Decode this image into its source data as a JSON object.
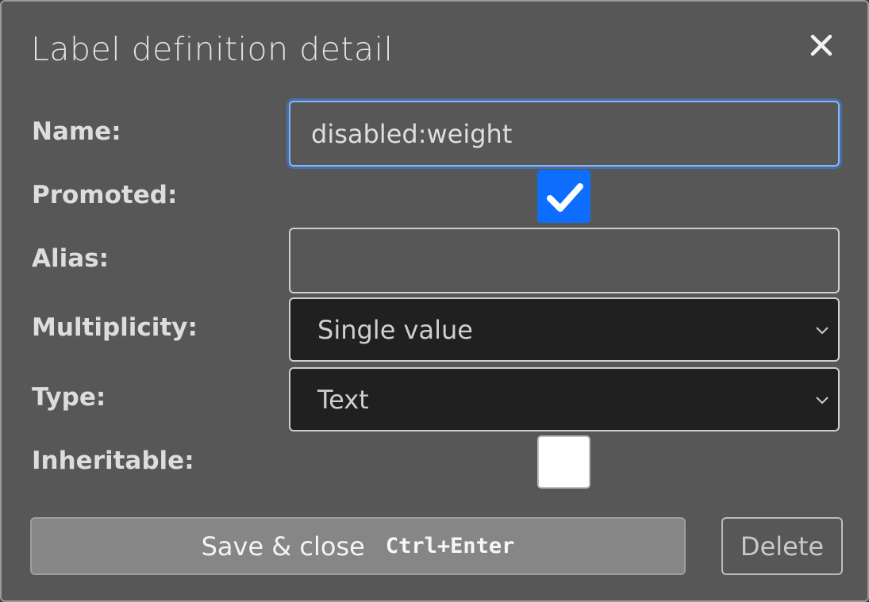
{
  "dialog": {
    "title": "Label definition detail",
    "close_icon": "close-icon"
  },
  "form": {
    "name": {
      "label": "Name:",
      "value": "disabled:weight"
    },
    "promoted": {
      "label": "Promoted:",
      "checked": true
    },
    "alias": {
      "label": "Alias:",
      "value": ""
    },
    "multiplicity": {
      "label": "Multiplicity:",
      "selected": "Single value"
    },
    "type": {
      "label": "Type:",
      "selected": "Text"
    },
    "inheritable": {
      "label": "Inheritable:",
      "checked": false
    }
  },
  "actions": {
    "save_label": "Save & close",
    "save_shortcut": "Ctrl+Enter",
    "delete_label": "Delete"
  },
  "colors": {
    "dialog_bg": "#575757",
    "accent": "#0d6efd",
    "focus_ring": "#8ab6f2",
    "select_bg": "#202020"
  }
}
